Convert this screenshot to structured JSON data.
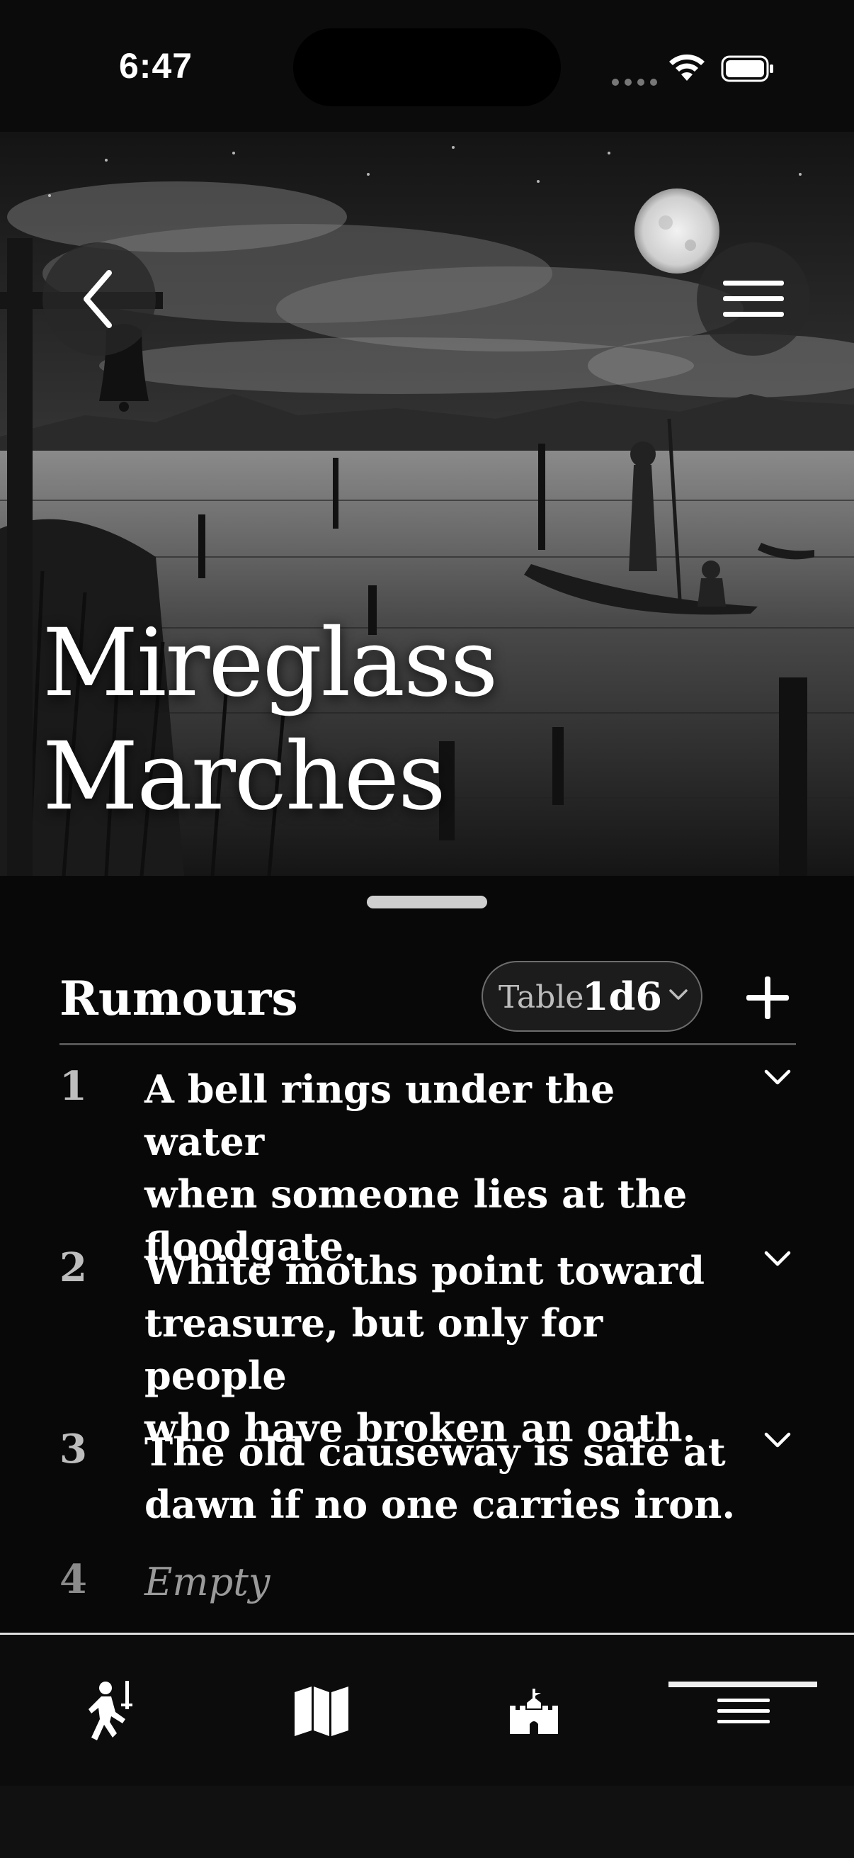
{
  "status_bar": {
    "time": "6:47"
  },
  "hero": {
    "title_line1": "Mireglass",
    "title_line2": "Marches"
  },
  "section": {
    "title": "Rumours",
    "table_label": "Table",
    "table_value": "1d6"
  },
  "rumours": [
    {
      "number": "1",
      "lines": [
        "A bell rings under the water",
        "when someone lies at the",
        "floodgate."
      ]
    },
    {
      "number": "2",
      "lines": [
        "White moths point toward",
        "treasure, but only for people",
        "who have broken an oath."
      ]
    },
    {
      "number": "3",
      "lines": [
        "The old causeway is safe at",
        "dawn if no one carries iron."
      ]
    },
    {
      "number": "4",
      "empty_label": "Empty"
    }
  ],
  "icons": {
    "back": "chevron-left-icon",
    "menu": "hamburger-icon",
    "add": "plus-icon",
    "tab1": "adventurer-icon",
    "tab2": "map-icon",
    "tab3": "castle-icon",
    "tab4": "list-icon"
  },
  "colors": {
    "background": "#080808",
    "text": "#ffffff",
    "muted": "#bdbdbd"
  }
}
